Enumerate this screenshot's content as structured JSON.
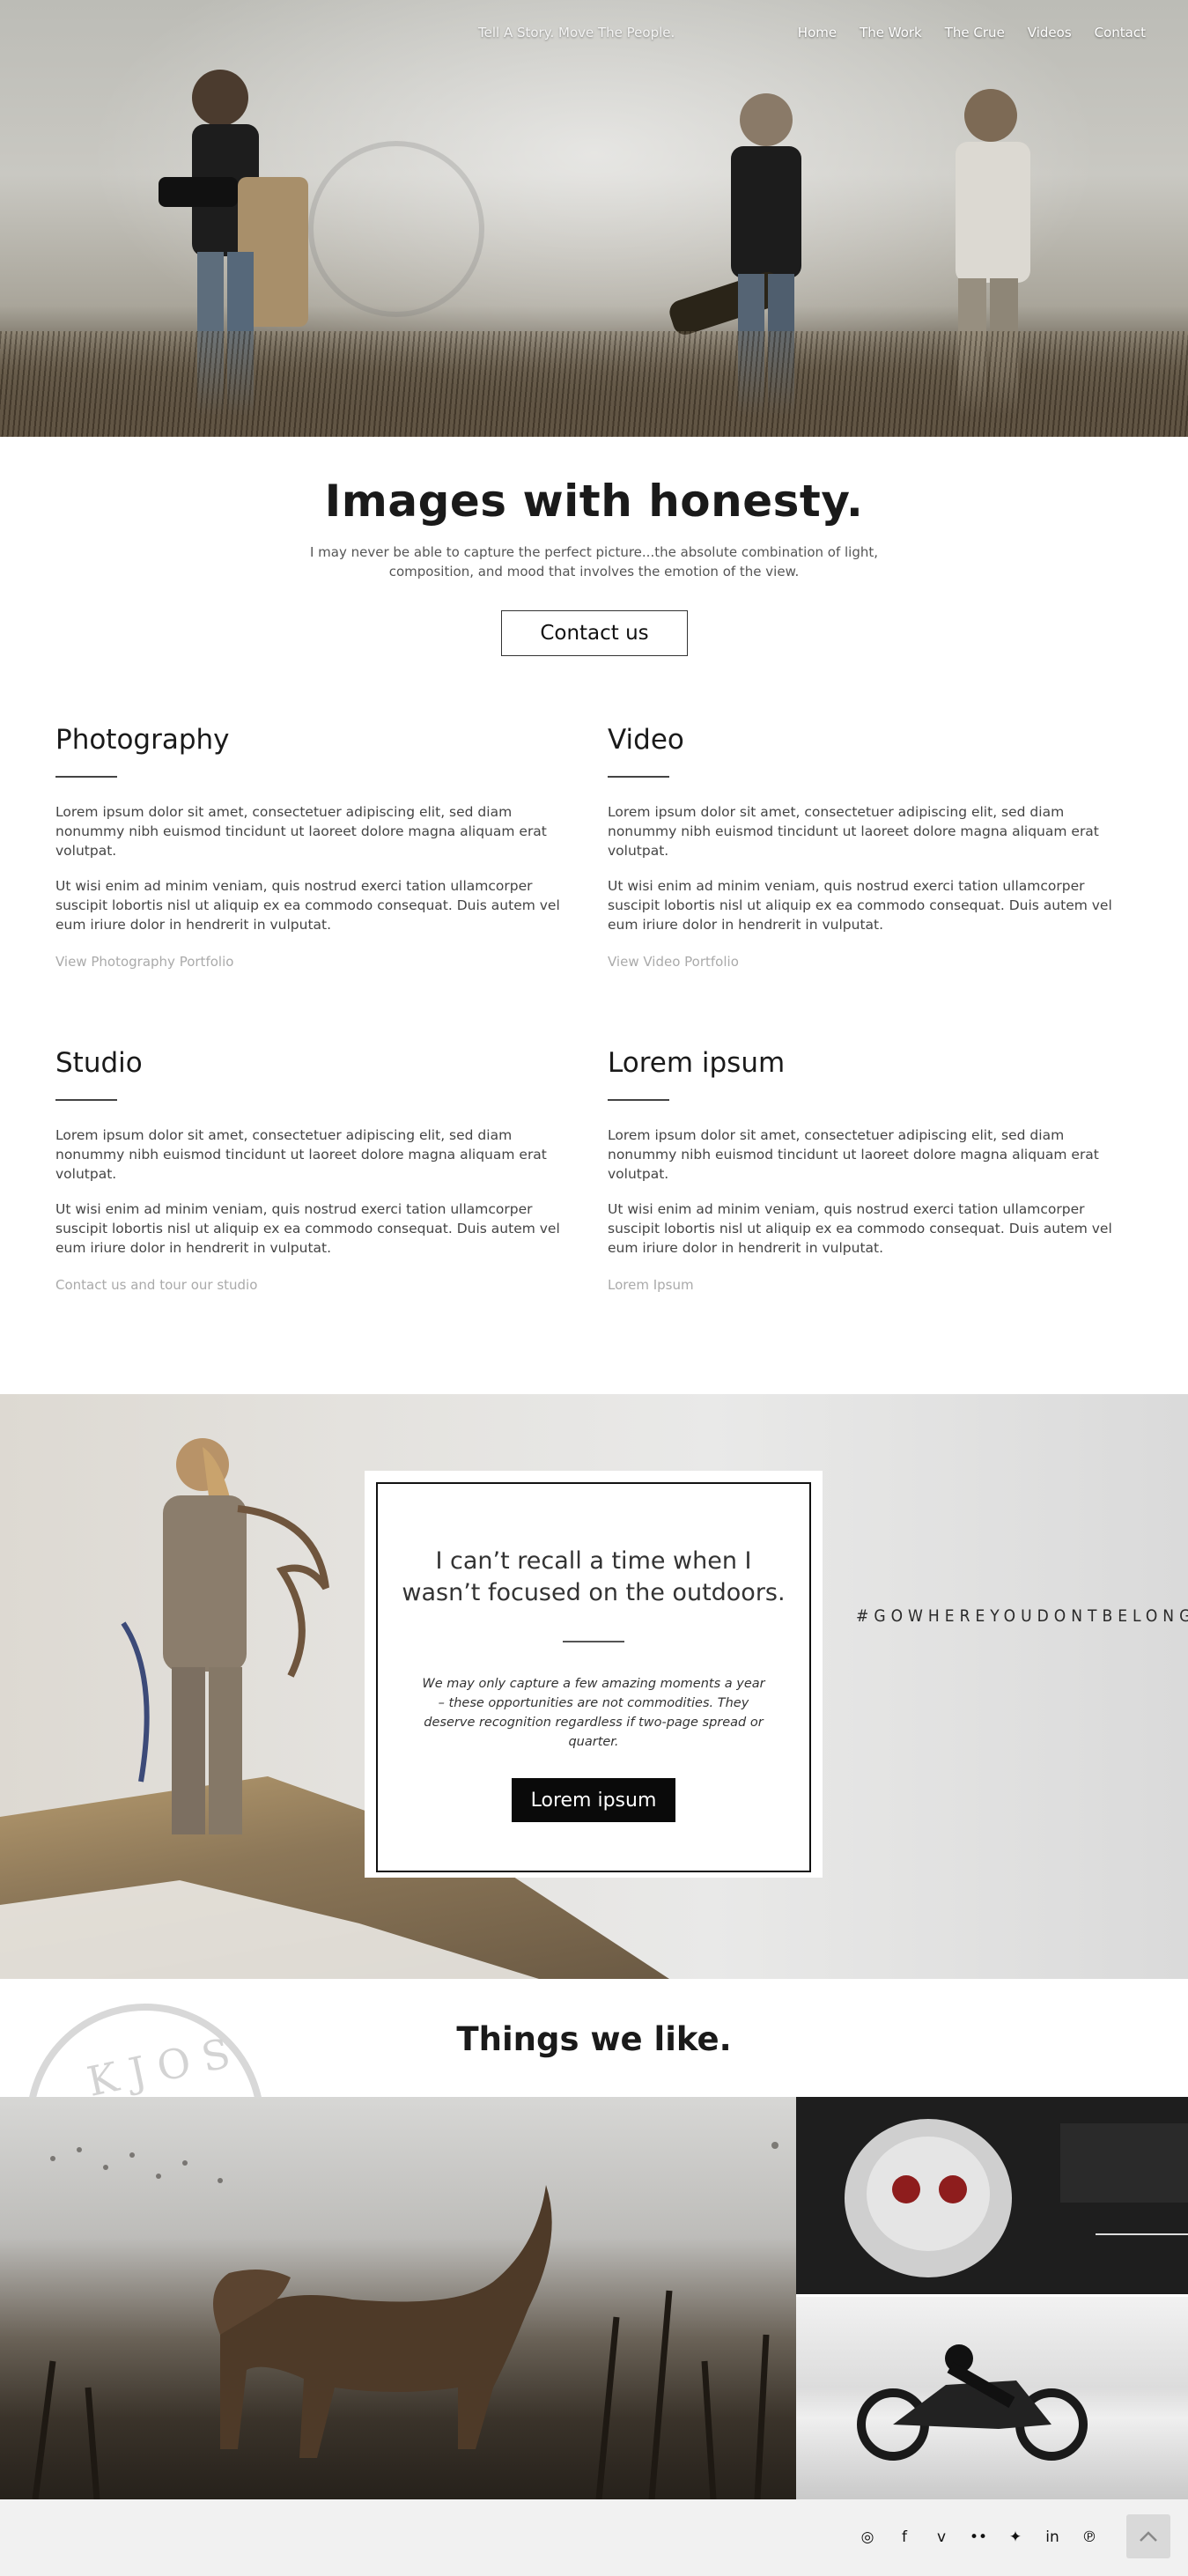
{
  "header": {
    "tagline": "Tell A Story. Move The People.",
    "nav": [
      "Home",
      "The Work",
      "The Crue",
      "Videos",
      "Contact"
    ]
  },
  "intro": {
    "title": "Images with honesty.",
    "text": "I may never be able to capture the perfect picture...the absolute combination of light, composition, and mood that involves the emotion of the view.",
    "button": "Contact us"
  },
  "services": [
    {
      "title": "Photography",
      "p1": "Lorem ipsum dolor sit amet, consectetuer adipiscing elit, sed diam nonummy nibh euismod tincidunt ut laoreet dolore magna aliquam erat volutpat.",
      "p2": "Ut wisi enim ad minim veniam, quis nostrud exerci tation ullamcorper suscipit lobortis nisl ut aliquip ex ea commodo consequat. Duis autem vel eum iriure dolor in hendrerit in vulputat.",
      "link": "View Photography Portfolio"
    },
    {
      "title": "Video",
      "p1": "Lorem ipsum dolor sit amet, consectetuer adipiscing elit, sed diam nonummy nibh euismod tincidunt ut laoreet dolore magna aliquam erat volutpat.",
      "p2": "Ut wisi enim ad minim veniam, quis nostrud exerci tation ullamcorper suscipit lobortis nisl ut aliquip ex ea commodo consequat. Duis autem vel eum iriure dolor in hendrerit in vulputat.",
      "link": "View Video Portfolio"
    },
    {
      "title": "Studio",
      "p1": "Lorem ipsum dolor sit amet, consectetuer adipiscing elit, sed diam nonummy nibh euismod tincidunt ut laoreet dolore magna aliquam erat volutpat.",
      "p2": "Ut wisi enim ad minim veniam, quis nostrud exerci tation ullamcorper suscipit lobortis nisl ut aliquip ex ea commodo consequat. Duis autem vel eum iriure dolor in hendrerit in vulputat.",
      "link": "Contact us and tour our studio"
    },
    {
      "title": "Lorem ipsum",
      "p1": "Lorem ipsum dolor sit amet, consectetuer adipiscing elit, sed diam nonummy nibh euismod tincidunt ut laoreet dolore magna aliquam erat volutpat.",
      "p2": "Ut wisi enim ad minim veniam, quis nostrud exerci tation ullamcorper suscipit lobortis nisl ut aliquip ex ea commodo consequat. Duis autem vel eum iriure dolor in hendrerit in vulputat.",
      "link": "Lorem Ipsum"
    }
  ],
  "promo": {
    "quote": "I can’t recall a time when I wasn’t focused on the outdoors.",
    "text": "We may only capture a few amazing moments a year – these opportunities are not commodities. They deserve recognition regardless if two-page spread or quarter.",
    "button": "Lorem ipsum",
    "hashtag": "#GOWHEREYOUDONTBELONG"
  },
  "things": {
    "title": "Things we like.",
    "seal_text": "KJOS"
  },
  "footer": {
    "social": [
      {
        "icon": "instagram-icon",
        "glyph": "◎"
      },
      {
        "icon": "facebook-icon",
        "glyph": "f"
      },
      {
        "icon": "vimeo-icon",
        "glyph": "v"
      },
      {
        "icon": "flickr-icon",
        "glyph": "••"
      },
      {
        "icon": "twitter-icon",
        "glyph": "✦"
      },
      {
        "icon": "linkedin-icon",
        "glyph": "in"
      },
      {
        "icon": "pinterest-icon",
        "glyph": "℗"
      }
    ],
    "to_top_icon": "chevron-up-icon"
  }
}
